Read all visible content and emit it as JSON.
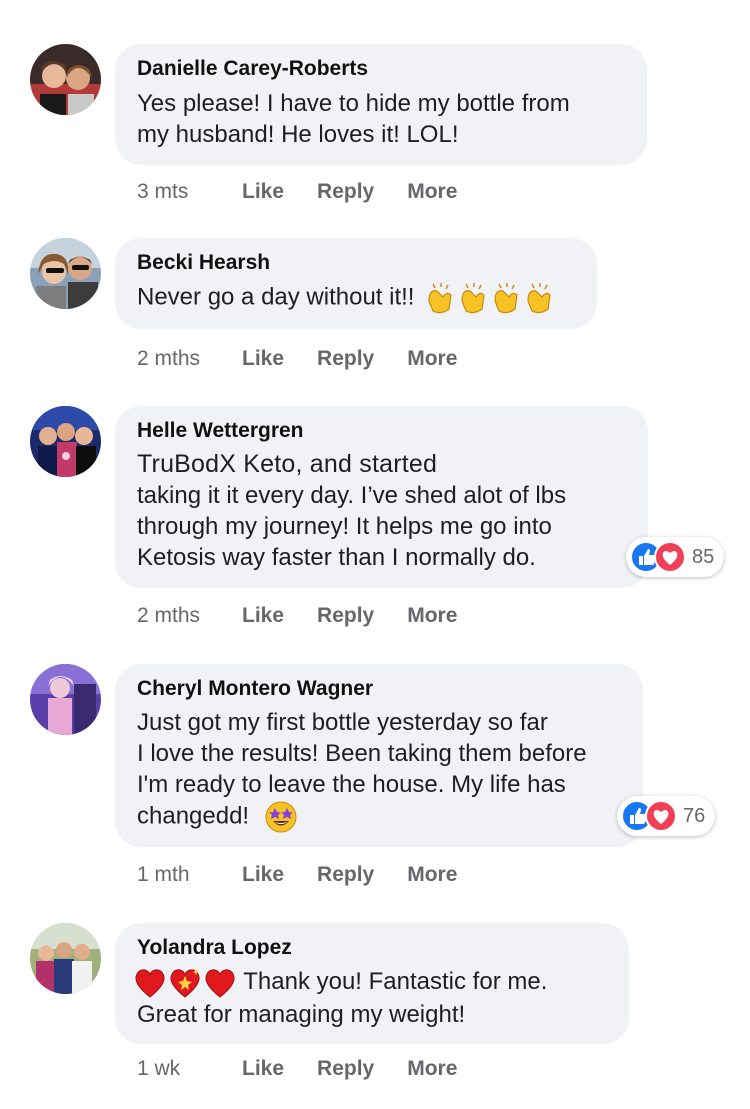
{
  "comments": [
    {
      "author": "Danielle Carey-Roberts",
      "lines": [
        "Yes please! I have to hide my bottle from",
        "my husband! He loves it! LOL!"
      ],
      "time": "3 mts",
      "actions": [
        "Like",
        "Reply",
        "More"
      ]
    },
    {
      "author": "Becki Hearsh",
      "lines": [
        "Never go a day without it!!"
      ],
      "emoji": [
        "clapping-hands",
        "clapping-hands",
        "clapping-hands",
        "clapping-hands"
      ],
      "time": "2 mths",
      "actions": [
        "Like",
        "Reply",
        "More"
      ]
    },
    {
      "author": "Helle Wettergren",
      "lines": [
        "TruBodX Keto, and started",
        "taking it it every day. I’ve shed alot of lbs",
        "through my journey! It helps me go into",
        "Ketosis way faster than I normally do."
      ],
      "reactions": {
        "count": "85",
        "icons": [
          "like-icon",
          "love-icon"
        ]
      },
      "time": "2 mths",
      "actions": [
        "Like",
        "Reply",
        "More"
      ]
    },
    {
      "author": "Cheryl Montero Wagner",
      "lines": [
        "Just got my first bottle yesterday so far",
        "I love the results! Been taking them before",
        "I'm ready to leave the house. My life has",
        "changedd!"
      ],
      "emoji": [
        "star-struck"
      ],
      "reactions": {
        "count": "76",
        "icons": [
          "like-icon",
          "love-icon"
        ]
      },
      "time": "1 mth",
      "actions": [
        "Like",
        "Reply",
        "More"
      ]
    },
    {
      "author": "Yolandra Lopez",
      "lines": [
        "Thank you! Fantastic for me.",
        "Great for managing my weight!"
      ],
      "emoji": [
        "red-heart",
        "sparkling-heart",
        "red-heart"
      ],
      "time": "1 wk",
      "actions": [
        "Like",
        "Reply",
        "More"
      ]
    }
  ],
  "colors": {
    "bubble": "#f0f2f5",
    "meta_text": "#65676b",
    "like_blue": "#1877f2",
    "love_red": "#f33e58"
  }
}
